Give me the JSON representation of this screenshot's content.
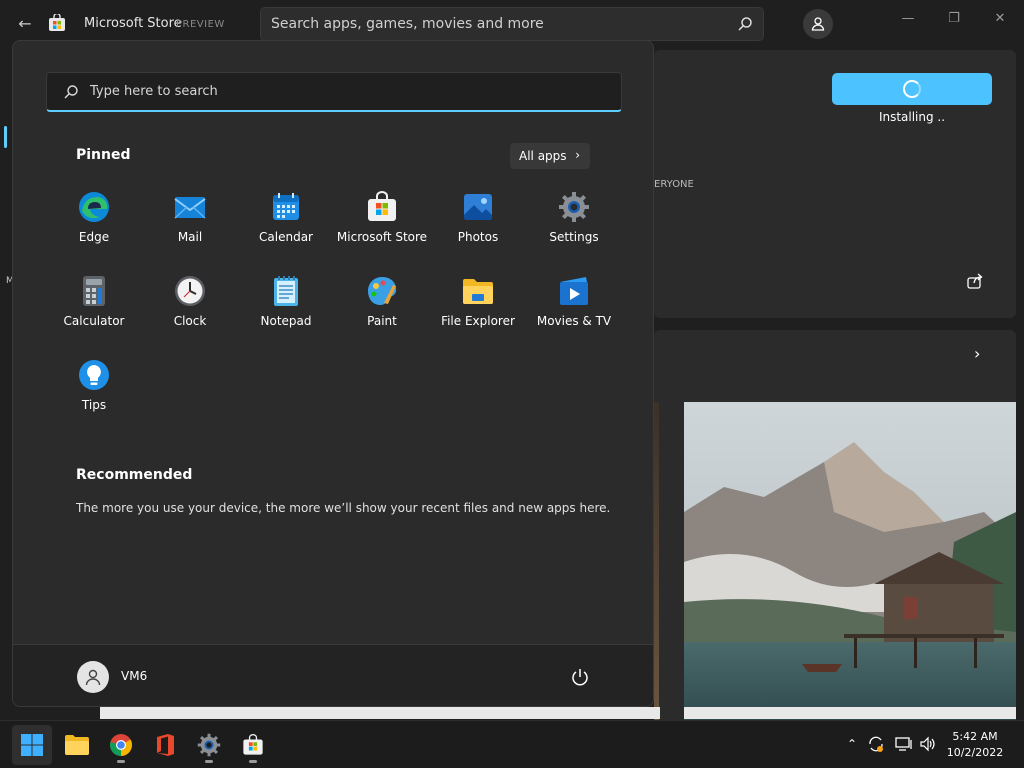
{
  "store": {
    "app_title": "Microsoft Store",
    "preview_tag": "PREVIEW",
    "search_placeholder": "Search apps, games, movies and more",
    "install_status": "Installing ..",
    "rating_fragment": "ERYONE",
    "left_fragment": "M"
  },
  "start_menu": {
    "search_placeholder": "Type here to search",
    "pinned_heading": "Pinned",
    "all_apps_label": "All apps",
    "pinned_apps": [
      {
        "label": "Edge",
        "icon": "edge-icon"
      },
      {
        "label": "Mail",
        "icon": "mail-icon"
      },
      {
        "label": "Calendar",
        "icon": "calendar-icon"
      },
      {
        "label": "Microsoft Store",
        "icon": "store-icon"
      },
      {
        "label": "Photos",
        "icon": "photos-icon"
      },
      {
        "label": "Settings",
        "icon": "settings-icon"
      },
      {
        "label": "Calculator",
        "icon": "calculator-icon"
      },
      {
        "label": "Clock",
        "icon": "clock-icon"
      },
      {
        "label": "Notepad",
        "icon": "notepad-icon"
      },
      {
        "label": "Paint",
        "icon": "paint-icon"
      },
      {
        "label": "File Explorer",
        "icon": "folder-icon"
      },
      {
        "label": "Movies & TV",
        "icon": "movies-icon"
      },
      {
        "label": "Tips",
        "icon": "tips-icon"
      }
    ],
    "recommended_heading": "Recommended",
    "recommended_text": "The more you use your device, the more we’ll show your recent files and new apps here.",
    "user_name": "VM6"
  },
  "taskbar": {
    "time": "5:42 AM",
    "date": "10/2/2022"
  },
  "colors": {
    "accent": "#60cdff",
    "install_button": "#4cc2ff"
  }
}
